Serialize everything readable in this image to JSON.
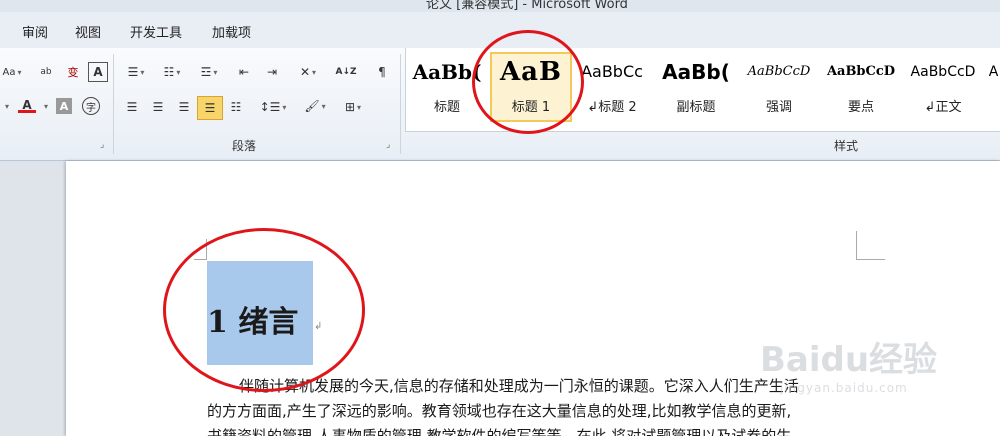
{
  "window": {
    "title": "论文 [兼容模式] - Microsoft Word"
  },
  "tabs": [
    "审阅",
    "视图",
    "开发工具",
    "加载项"
  ],
  "ribbon": {
    "paragraph_group_label": "段落",
    "styles_group_label": "样式",
    "font_partial_label": "Aa",
    "sort_label": "A↓Z",
    "styles": [
      {
        "preview": "AaBb(",
        "name": "标题"
      },
      {
        "preview": "AaB",
        "name": "标题 1",
        "selected": true
      },
      {
        "preview": "AaBbCc",
        "name": "↲标题 2"
      },
      {
        "preview": "AaBb(",
        "name": "副标题"
      },
      {
        "preview": "AaBbCcD",
        "name": "强调"
      },
      {
        "preview": "AaBbCcD",
        "name": "要点"
      },
      {
        "preview": "AaBbCcD",
        "name": "↲正文"
      },
      {
        "preview": "A",
        "name": ""
      }
    ],
    "colors": {
      "font_color": "#e0151b",
      "highlight_active": "#f8d56b"
    }
  },
  "document": {
    "heading": "1  绪言",
    "paragraph_mark": "↲",
    "lines": [
      "伴随计算机发展的今天,信息的存储和处理成为一门永恒的课题。它深入人们生产生活",
      "的方方面面,产生了深远的影响。教育领域也存在这大量信息的处理,比如教学信息的更新,",
      "书籍资料的管理,人事物质的管理,教学软件的编写等等。在此,将对试题管理以及试卷的生"
    ]
  },
  "watermark": {
    "brand": "Baidu经验",
    "url": "jingyan.baidu.com"
  },
  "annotation": {
    "color": "#e0151b"
  }
}
